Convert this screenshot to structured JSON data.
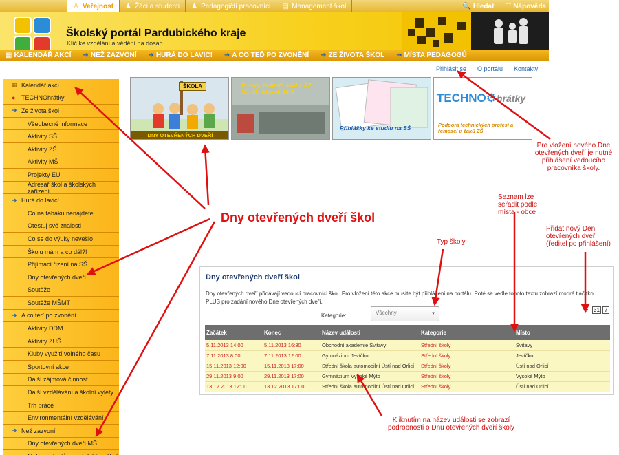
{
  "top_tabs": [
    {
      "label": "Veřejnost",
      "icon": "people-icon"
    },
    {
      "label": "Žáci a studenti",
      "icon": "student-icon"
    },
    {
      "label": "Pedagogičtí pracovníci",
      "icon": "teacher-icon"
    },
    {
      "label": "Management škol",
      "icon": "management-icon"
    }
  ],
  "top_right": {
    "search": "Hledat",
    "help": "Nápověda"
  },
  "header": {
    "title": "Školský portál Pardubického kraje",
    "subtitle": "Klíč ke vzdělání a vědění na dosah"
  },
  "nav": [
    "KALENDÁŘ AKCÍ",
    "NEŽ ZAZVONÍ",
    "HURÁ DO LAVIC!",
    "A CO TEĎ PO ZVONĚNÍ",
    "ZE ŽIVOTA ŠKOL",
    "MÍSTA PEDAGOGŮ"
  ],
  "sidebar": [
    {
      "label": "Kalendář akcí",
      "level": "top",
      "bullet": "cal"
    },
    {
      "label": "TECHNOhrátky",
      "level": "top",
      "bullet": "red"
    },
    {
      "label": "Ze života škol",
      "level": "top",
      "bullet": "arrow"
    },
    {
      "label": "Všeobecné informace",
      "level": "sub"
    },
    {
      "label": "Aktivity SŠ",
      "level": "sub"
    },
    {
      "label": "Aktivity ZŠ",
      "level": "sub"
    },
    {
      "label": "Aktivity MŠ",
      "level": "sub"
    },
    {
      "label": "Projekty EU",
      "level": "sub"
    },
    {
      "label": "Adresář škol a školských zařízení",
      "level": "sub"
    },
    {
      "label": "Hurá do lavic!",
      "level": "top",
      "bullet": "arrow"
    },
    {
      "label": "Co na taháku nenajdete",
      "level": "sub"
    },
    {
      "label": "Otestuj své znalosti",
      "level": "sub"
    },
    {
      "label": "Co se do výuky nevešlo",
      "level": "sub"
    },
    {
      "label": "Školu mám a co dál?!",
      "level": "sub"
    },
    {
      "label": "Přijímací řízení na SŠ",
      "level": "sub"
    },
    {
      "label": "Dny otevřených dveří",
      "level": "sub"
    },
    {
      "label": "Soutěže",
      "level": "sub"
    },
    {
      "label": "Soutěže MŠMT",
      "level": "sub"
    },
    {
      "label": "A co teď po zvonění",
      "level": "top",
      "bullet": "arrow"
    },
    {
      "label": "Aktivity DDM",
      "level": "sub"
    },
    {
      "label": "Aktivity ZUŠ",
      "level": "sub"
    },
    {
      "label": "Kluby využití volného času",
      "level": "sub"
    },
    {
      "label": "Sportovní akce",
      "level": "sub"
    },
    {
      "label": "Další zájmová činnost",
      "level": "sub"
    },
    {
      "label": "Další vzdělávání a školní výlety",
      "level": "sub"
    },
    {
      "label": "Trh práce",
      "level": "sub"
    },
    {
      "label": "Environmentální vzdělávání",
      "level": "sub"
    },
    {
      "label": "Než zazvoní",
      "level": "top",
      "bullet": "arrow"
    },
    {
      "label": "Dny otevřených dveří MŠ",
      "level": "sub"
    },
    {
      "label": "Malým adeptům mateřských škol",
      "level": "sub"
    }
  ],
  "right_links": {
    "login": "Přihlásit se",
    "about": "O portálu",
    "contacts": "Kontakty"
  },
  "banners": {
    "b1_sign": "ŠKOLA",
    "b1_caption": "DNY OTEVŘENÝCH DVEŘÍ",
    "b2_title": "Porady ředitelů škol a ŠZ",
    "b2_date": "18. - 22. listopadu 2013",
    "b3_caption": "Přihlášky ke studiu na SŠ",
    "b4_logo_a": "TECHNO",
    "b4_logo_b": "hrátky",
    "b4_caption": "Podpora technických profesí a řemesel u žáků ZŠ"
  },
  "panel": {
    "title": "Dny otevřených dveří škol",
    "description": "Dny otevřených dveří přidávají vedoucí pracovníci škol. Pro vložení této akce musíte být přihlášeni na portálu. Poté se vedle tohoto textu zobrazí modré tlačítko PLUS pro zadání nového Dne otevřených dveří.",
    "kategorie_label": "Kategorie:",
    "kategorie_value": "Všechny",
    "cal31": "31",
    "cal7": "7"
  },
  "table": {
    "headers": [
      "Začátek",
      "Konec",
      "Název události",
      "Kategorie",
      "Místo"
    ],
    "rows": [
      [
        "5.11.2013 14:00",
        "5.11.2013 16:30",
        "Obchodní akademie Svitavy",
        "Střední školy",
        "Svitavy"
      ],
      [
        "7.11.2013 8:00",
        "7.11.2013 12:00",
        "Gymnázium Jevíčko",
        "Střední školy",
        "Jevíčko"
      ],
      [
        "15.11.2013 12:00",
        "15.11.2013 17:00",
        "Střední škola automobilní Ústí nad Orlicí",
        "Střední školy",
        "Ústí nad Orlicí"
      ],
      [
        "29.11.2013 9:00",
        "29.11.2013 17:00",
        "Gymnázium Vysoké Mýto",
        "Střední školy",
        "Vysoké Mýto"
      ],
      [
        "13.12.2013 12:00",
        "13.12.2013 17:00",
        "Střední škola automobilní Ústí nad Orlicí",
        "Střední školy",
        "Ústí nad Orlicí"
      ]
    ]
  },
  "annotations": {
    "big": "Dny otevřených dveří škol",
    "login_note": "Pro vložení nového Dne otevřených dveří je nutné přihlášení vedoucího pracovníka školy.",
    "sort_note": "Seznam lze seřadit podle místa - obce",
    "add_note": "Přidat nový Den otevřených dveří (ředitel po přihlášení)",
    "type_note": "Typ školy",
    "click_note": "Kliknutím na název události se zobrazí podrobnosti o Dnu otevřených dveří školy"
  },
  "colors": {
    "accent": "#f0a000",
    "link": "#2466b0",
    "annotation": "#e01010"
  }
}
